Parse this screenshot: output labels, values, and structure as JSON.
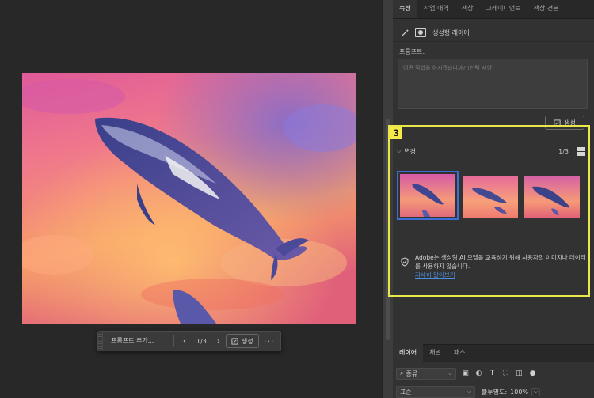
{
  "panel": {
    "tabs": [
      "속성",
      "작업 내역",
      "색상",
      "그레이디언트",
      "색상 견본"
    ],
    "layer_type_label": "생성형 레이어",
    "prompt_label": "프롬프트:",
    "prompt_placeholder": "어떤 작업을 하시겠습니까? (선택 사항)",
    "generate_label": "생성"
  },
  "annotation": {
    "number": "3",
    "color": "#e8e84a"
  },
  "variations": {
    "title": "변경",
    "counter": "1/3",
    "selected_index": 1
  },
  "notice": {
    "text": "Adobe는 생성형 AI 모델을 교육하기 위해 사용자의 이미지나 데이터를 사용하지 않습니다.",
    "link": "자세히 알아보기"
  },
  "context_bar": {
    "prompt_placeholder": "프롬프트 추가...",
    "counter": "1/3",
    "generate_label": "생성",
    "more_label": "···"
  },
  "layers": {
    "tabs": [
      "레이어",
      "채널",
      "패스"
    ],
    "filter_label": "종류",
    "blend_mode": "표준",
    "opacity_label": "불투명도:",
    "opacity_value": "100%"
  },
  "colors": {
    "selection_outline": "#3b6fd6",
    "link": "#4a90e2"
  },
  "icons": {
    "wand": "magic-wand-icon",
    "mask": "layer-mask-icon",
    "generate": "generate-sparkle-icon",
    "shield": "shield-check-icon",
    "grid": "grid-view-icon"
  }
}
